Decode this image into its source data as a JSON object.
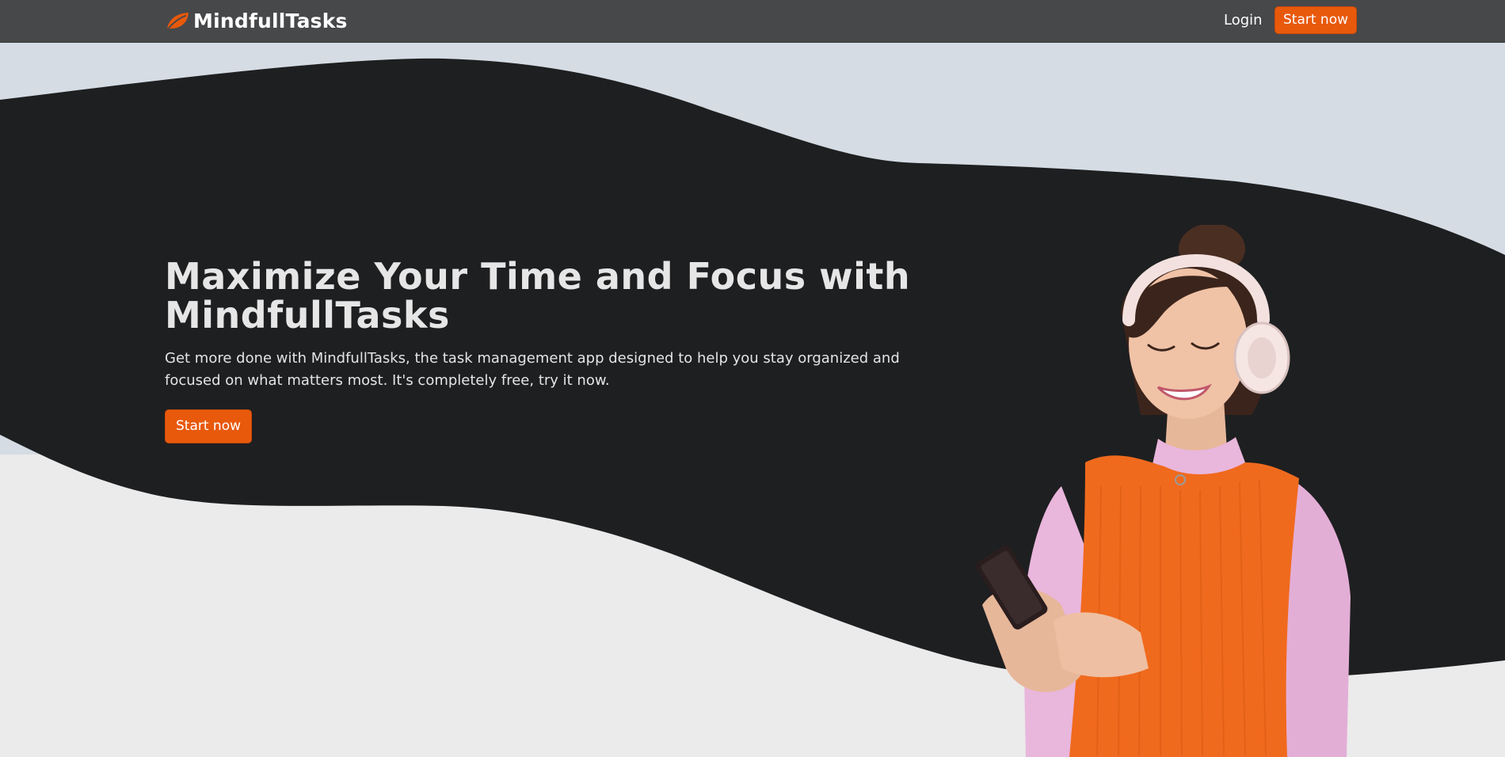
{
  "nav": {
    "brand_name": "MindfullTasks",
    "brand_icon": "leaf-icon",
    "login_label": "Login",
    "start_label": "Start now"
  },
  "hero": {
    "title": "Maximize Your Time and Focus with MindfullTasks",
    "subtitle": "Get more done with MindfullTasks, the task management app designed to help you stay organized and focused on what matters most. It's completely free, try it now.",
    "cta_label": "Start now",
    "image_alt": "woman-with-headphones-using-phone"
  },
  "colors": {
    "accent": "#e8590c",
    "navbar": "#47484a",
    "hero_band": "#1e1f21",
    "sky": "#d5dce3",
    "floor": "#ebebeb"
  }
}
